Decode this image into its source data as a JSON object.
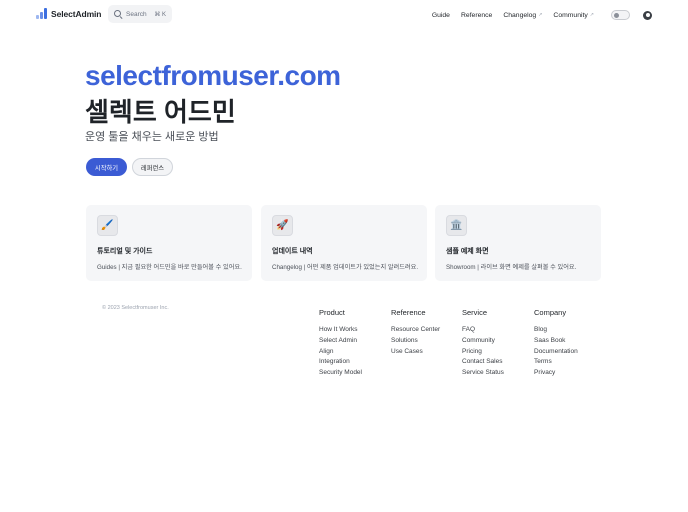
{
  "header": {
    "brand": "SelectAdmin",
    "search": {
      "placeholder": "Search",
      "shortcut": "⌘ K"
    },
    "nav": [
      {
        "label": "Guide",
        "external": false
      },
      {
        "label": "Reference",
        "external": false
      },
      {
        "label": "Changelog",
        "external": true
      },
      {
        "label": "Community",
        "external": true
      }
    ],
    "external_glyph": "↗"
  },
  "hero": {
    "title": "selectfromuser.com",
    "subtitle": "셀렉트 어드민",
    "description": "운영 툴을 채우는 새로운 방법",
    "primary_button": "시작하기",
    "secondary_button": "레퍼런스",
    "accent_color": "#3d63d8"
  },
  "cards": [
    {
      "icon": "brush-icon",
      "emoji": "🖌️",
      "title": "튜토리얼 및 가이드",
      "description": "Guides | 지금 필요한 어드민을 바로 만들어볼 수 있어요."
    },
    {
      "icon": "rocket-icon",
      "emoji": "🚀",
      "title": "업데이트 내역",
      "description": "Changelog | 어떤 제품 업데이트가 있었는지 알려드려요."
    },
    {
      "icon": "building-icon",
      "emoji": "🏛️",
      "title": "샘플 예제 화면",
      "description": "Showroom | 라이브 화면 예제를 살펴볼 수 있어요."
    }
  ],
  "footer": {
    "copyright": "© 2023 Selectfromuser Inc.",
    "columns": [
      {
        "title": "Product",
        "items": [
          "How It Works",
          "Select Admin",
          "Align",
          "Integration",
          "Security Model"
        ]
      },
      {
        "title": "Reference",
        "items": [
          "Resource Center",
          "Solutions",
          "Use Cases"
        ]
      },
      {
        "title": "Service",
        "items": [
          "FAQ",
          "Community",
          "Pricing",
          "Contact Sales",
          "Service Status"
        ]
      },
      {
        "title": "Company",
        "items": [
          "Blog",
          "Saas Book",
          "Documentation",
          "Terms",
          "Privacy"
        ]
      }
    ]
  }
}
